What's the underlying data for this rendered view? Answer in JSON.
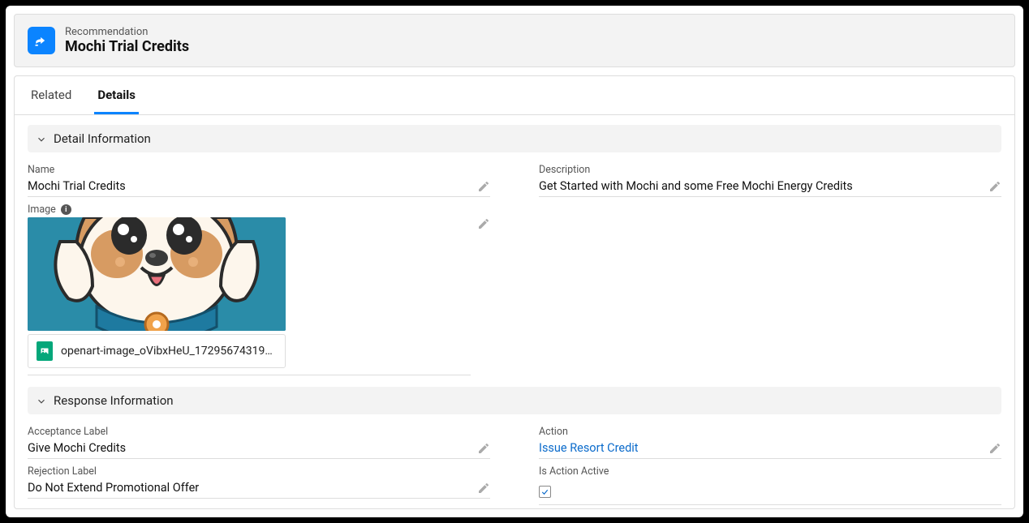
{
  "header": {
    "object_label": "Recommendation",
    "title": "Mochi Trial Credits"
  },
  "tabs": {
    "related": "Related",
    "details": "Details",
    "active": "details"
  },
  "sections": {
    "detail_info": {
      "title": "Detail Information",
      "name_label": "Name",
      "name_value": "Mochi Trial Credits",
      "description_label": "Description",
      "description_value": "Get Started with Mochi and some Free Mochi Energy Credits",
      "image_label": "Image",
      "image_filename": "openart-image_oVibxHeU_17295674319…"
    },
    "response_info": {
      "title": "Response Information",
      "acceptance_label_label": "Acceptance Label",
      "acceptance_label_value": "Give Mochi Credits",
      "action_label": "Action",
      "action_value": "Issue Resort Credit",
      "rejection_label_label": "Rejection Label",
      "rejection_label_value": "Do Not Extend Promotional Offer",
      "is_action_active_label": "Is Action Active",
      "is_action_active_value": true
    }
  }
}
